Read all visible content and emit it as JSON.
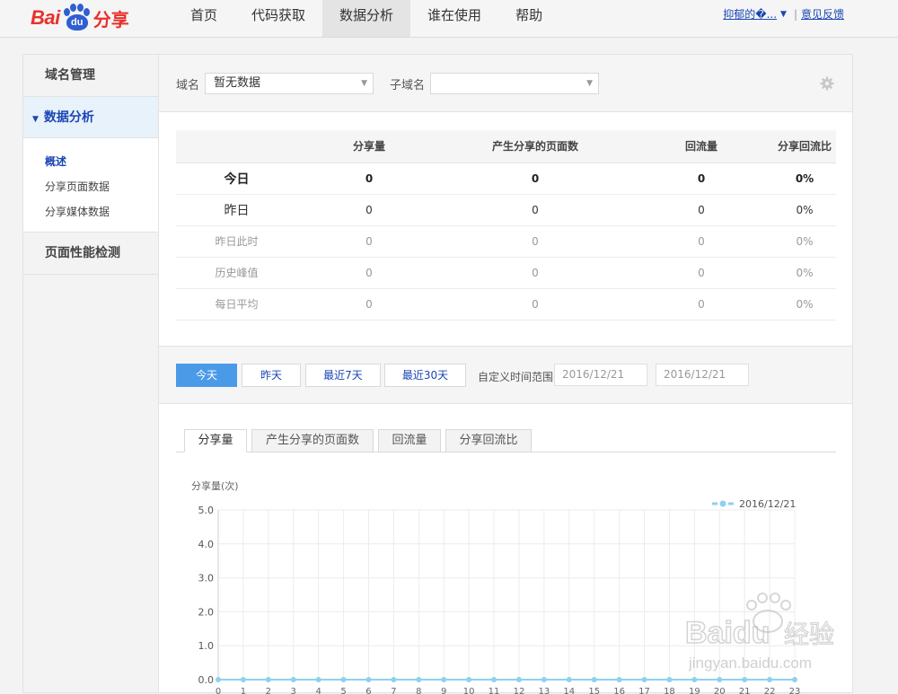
{
  "header": {
    "logo": {
      "bai": "Bai",
      "du": "du",
      "share": "分享"
    },
    "nav": [
      {
        "label": "首页",
        "active": false
      },
      {
        "label": "代码获取",
        "active": false
      },
      {
        "label": "数据分析",
        "active": true
      },
      {
        "label": "谁在使用",
        "active": false
      },
      {
        "label": "帮助",
        "active": false
      }
    ],
    "user": "抑郁的�...",
    "feedback": "意见反馈"
  },
  "sidebar": {
    "domain_mgmt": "域名管理",
    "data_analysis": "数据分析",
    "sub_items": [
      "概述",
      "分享页面数据",
      "分享媒体数据"
    ],
    "perf": "页面性能检测"
  },
  "filter": {
    "domain_label": "域名",
    "domain_value": "暂无数据",
    "subdomain_label": "子域名",
    "subdomain_value": ""
  },
  "stats_table": {
    "headers": [
      "",
      "分享量",
      "产生分享的页面数",
      "回流量",
      "分享回流比"
    ],
    "rows": [
      [
        "今日",
        "0",
        "0",
        "0",
        "0%"
      ],
      [
        "昨日",
        "0",
        "0",
        "0",
        "0%"
      ],
      [
        "昨日此时",
        "0",
        "0",
        "0",
        "0%"
      ],
      [
        "历史峰值",
        "0",
        "0",
        "0",
        "0%"
      ],
      [
        "每日平均",
        "0",
        "0",
        "0",
        "0%"
      ]
    ]
  },
  "range": {
    "buttons": [
      "今天",
      "昨天",
      "最近7天",
      "最近30天"
    ],
    "custom_label": "自定义时间范围",
    "start_date": "2016/12/21",
    "end_date": "2016/12/21"
  },
  "tabs": [
    "分享量",
    "产生分享的页面数",
    "回流量",
    "分享回流比"
  ],
  "chart_data": {
    "type": "line",
    "ylabel": "分享量(次)",
    "xlabel": "",
    "ylim": [
      0,
      5
    ],
    "yticks": [
      "0.0",
      "1.0",
      "2.0",
      "3.0",
      "4.0",
      "5.0"
    ],
    "x": [
      0,
      1,
      2,
      3,
      4,
      5,
      6,
      7,
      8,
      9,
      10,
      11,
      12,
      13,
      14,
      15,
      16,
      17,
      18,
      19,
      20,
      21,
      22,
      23
    ],
    "series": [
      {
        "name": "2016/12/21",
        "values": [
          0,
          0,
          0,
          0,
          0,
          0,
          0,
          0,
          0,
          0,
          0,
          0,
          0,
          0,
          0,
          0,
          0,
          0,
          0,
          0,
          0,
          0,
          0,
          0
        ],
        "color": "#8fd0ee"
      }
    ],
    "legend": "top-right",
    "grid": true
  },
  "watermark": {
    "brand": "Baidu",
    "sub": "经验",
    "url": "jingyan.baidu.com"
  },
  "colors": {
    "accent": "#4a9ae8",
    "brand_red": "#e8312a",
    "brand_blue": "#2f5fd0",
    "link": "#1a46b4"
  }
}
